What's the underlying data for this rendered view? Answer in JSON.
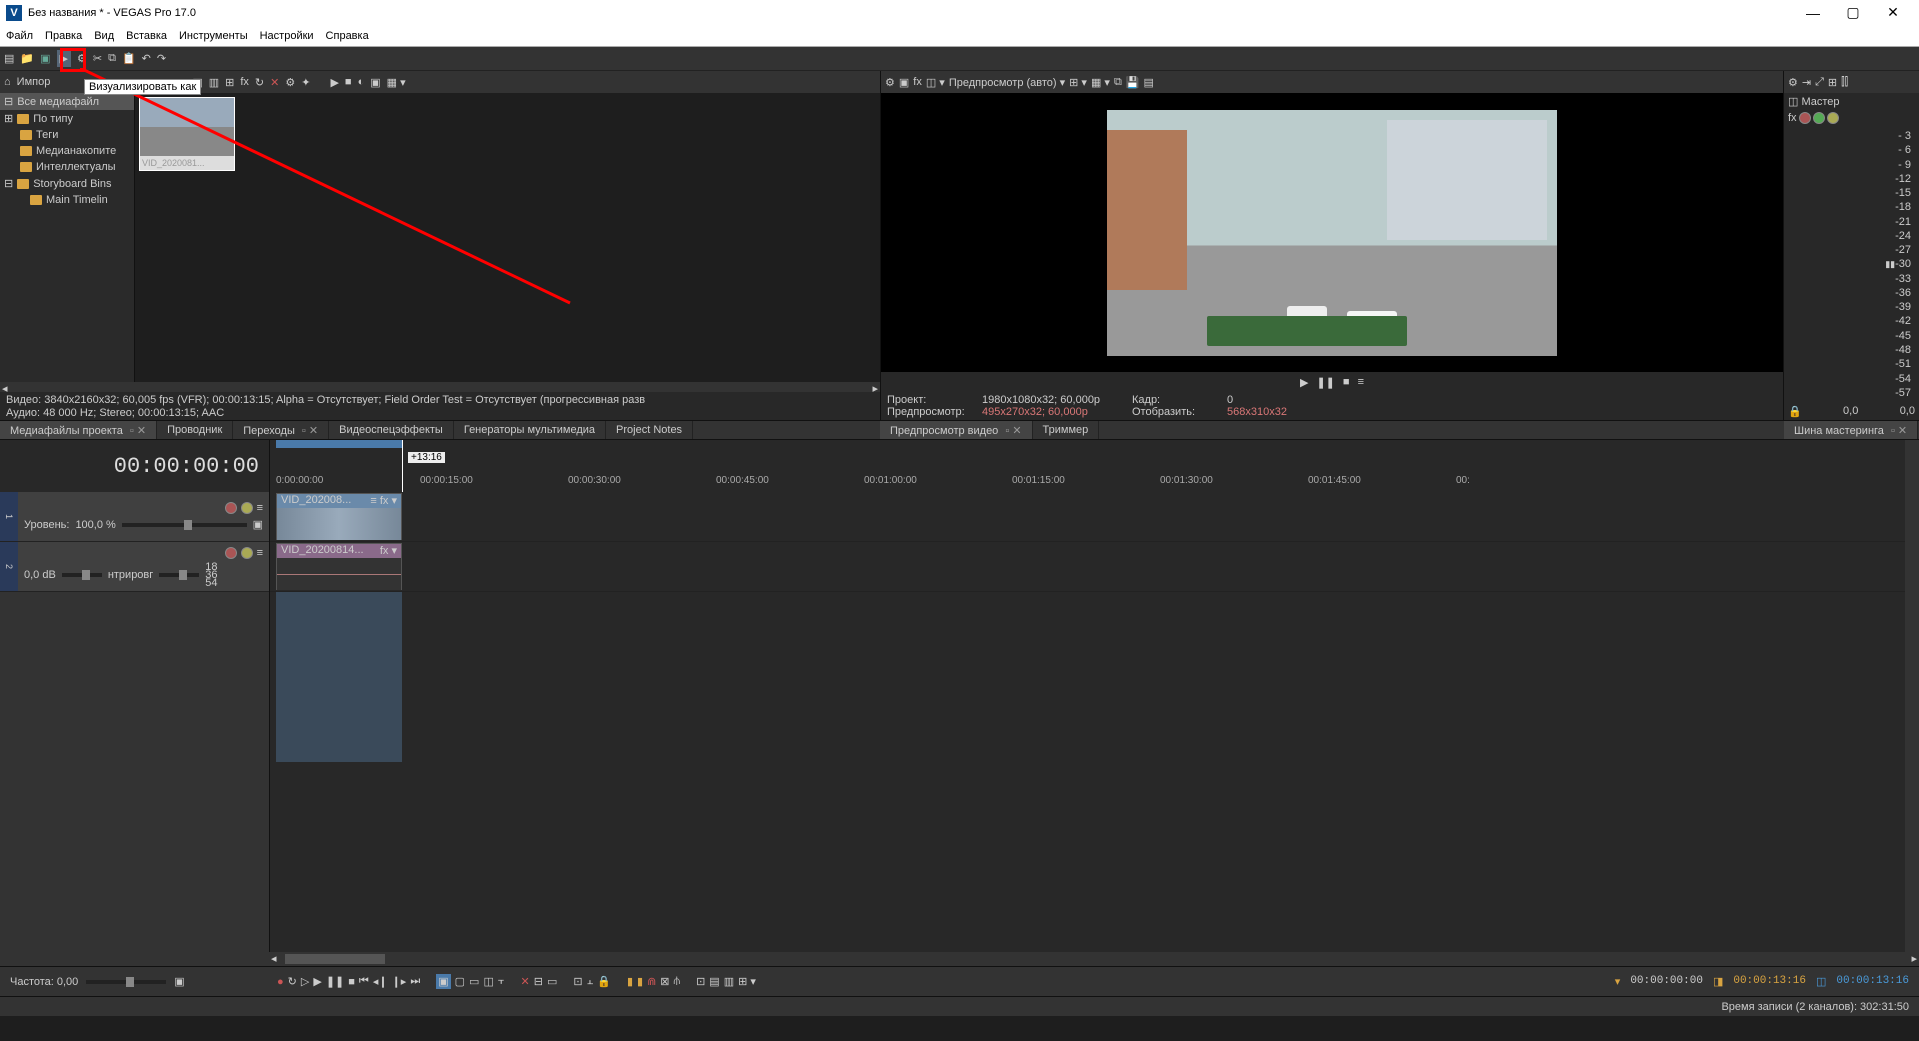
{
  "window": {
    "title": "Без названия * - VEGAS Pro 17.0"
  },
  "menubar": [
    "Файл",
    "Правка",
    "Вид",
    "Вставка",
    "Инструменты",
    "Настройки",
    "Справка"
  ],
  "tooltip": "Визуализировать как",
  "media": {
    "import_label": "Импор",
    "tree": [
      {
        "label": "Все медиафайл",
        "sel": true,
        "indent": 0,
        "expander": ""
      },
      {
        "label": "По типу",
        "indent": 0,
        "expander": "+"
      },
      {
        "label": "Теги",
        "indent": 1
      },
      {
        "label": "Медианакопите",
        "indent": 1
      },
      {
        "label": "Интеллектуалы",
        "indent": 1
      },
      {
        "label": "Storyboard Bins",
        "indent": 0,
        "expander": "−"
      },
      {
        "label": "Main Timelin",
        "indent": 2
      }
    ],
    "thumb_caption": "VID_2020081...",
    "info_video": "Видео: 3840x2160x32; 60,005 fps (VFR); 00:00:13:15; Alpha = Отсутствует; Field Order Test = Отсутствует (прогрессивная разв",
    "info_audio": "Аудио: 48 000 Hz; Stereo; 00:00:13:15; AAC"
  },
  "preview": {
    "quality_label": "Предпросмотр (авто) ▾",
    "stat": {
      "project_lbl": "Проект:",
      "project_val": "1980x1080x32; 60,000p",
      "frame_lbl": "Кадр:",
      "frame_val": "0",
      "preview_lbl": "Предпросмотр:",
      "preview_val": "495x270x32; 60,000p",
      "display_lbl": "Отобразить:",
      "display_val": "568x310x32"
    }
  },
  "master": {
    "title": "Мастер",
    "scale": [
      "- 3",
      "- 6",
      "- 9",
      "-12",
      "-15",
      "-18",
      "-21",
      "-24",
      "-27",
      "-30",
      "-33",
      "-36",
      "-39",
      "-42",
      "-45",
      "-48",
      "-51",
      "-54",
      "-57"
    ],
    "left": "0,0",
    "right": "0,0"
  },
  "tabs_left": [
    {
      "label": "Медиафайлы проекта",
      "close": true,
      "act": true
    },
    {
      "label": "Проводник"
    },
    {
      "label": "Переходы",
      "close": true
    },
    {
      "label": "Видеоспецэффекты"
    },
    {
      "label": "Генераторы мультимедиа"
    },
    {
      "label": "Project Notes"
    }
  ],
  "tabs_mid": [
    {
      "label": "Предпросмотр видео",
      "close": true,
      "act": true
    },
    {
      "label": "Триммер"
    }
  ],
  "tabs_right": [
    {
      "label": "Шина мастеринга",
      "close": true,
      "act": true
    }
  ],
  "timeline": {
    "timecode": "00:00:00:00",
    "badge": "+13:16",
    "ruler": [
      "0:00:00:00",
      "00:00:15:00",
      "00:00:30:00",
      "00:00:45:00",
      "00:01:00:00",
      "00:01:15:00",
      "00:01:30:00",
      "00:01:45:00",
      "00:"
    ],
    "track1": {
      "num": "1",
      "label": "Уровень:",
      "val": "100,0 %"
    },
    "track2": {
      "num": "2",
      "db": "0,0 dB",
      "pan": "нтрировг",
      "scale": [
        "18",
        "36",
        "54"
      ]
    },
    "clip_v_name": "VID_202008...",
    "clip_a_name": "VID_20200814...",
    "rate_lbl": "Частота: 0,00",
    "tc1": "00:00:00:00",
    "tc2": "00:00:13:16",
    "tc3": "00:00:13:16"
  },
  "status": "Время записи (2 каналов): 302:31:50"
}
